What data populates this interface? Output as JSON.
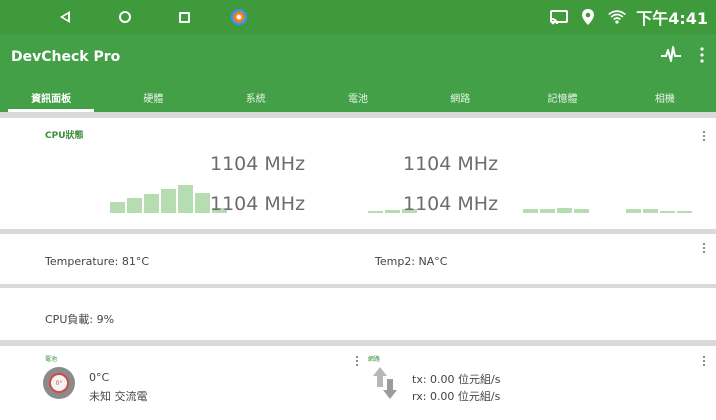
{
  "system_status": {
    "time": "下午4:41",
    "icons": [
      "back-icon",
      "home-icon",
      "recent-icon",
      "app-icon",
      "cast-icon",
      "location-icon",
      "wifi-icon"
    ]
  },
  "app": {
    "title": "DevCheck Pro",
    "actions": [
      "pulse-icon",
      "more-icon"
    ]
  },
  "tabs": [
    {
      "label": "資訊面板",
      "active": true
    },
    {
      "label": "硬體",
      "active": false
    },
    {
      "label": "系統",
      "active": false
    },
    {
      "label": "電池",
      "active": false
    },
    {
      "label": "網路",
      "active": false
    },
    {
      "label": "記憶體",
      "active": false
    },
    {
      "label": "相機",
      "active": false
    }
  ],
  "cpu": {
    "title": "CPU狀態",
    "freqs": [
      "1104 MHz",
      "1104 MHz",
      "1104 MHz",
      "1104 MHz"
    ],
    "bar_groups": [
      [
        0.32,
        0.45,
        0.55,
        0.7,
        0.82,
        0.58,
        0.15
      ],
      [
        0.05,
        0.08,
        0.12
      ],
      [
        0.12,
        0.12,
        0.14,
        0.12
      ],
      [
        0.12,
        0.12,
        0.05,
        0.05
      ]
    ]
  },
  "temperature": {
    "temp1": "Temperature: 81°C",
    "temp2": "Temp2: NA°C"
  },
  "cpu_load": {
    "text": "CPU負載: 9%"
  },
  "battery": {
    "label": "電池",
    "icon_text": "0°",
    "temp": "0°C",
    "status": "未知 交流電"
  },
  "network": {
    "label": "網路",
    "tx": "tx: 0.00 位元組/s",
    "rx": "rx: 0.00 位元組/s"
  },
  "colors": {
    "status_bar": "#3f9a3c",
    "app_bar": "#43a047",
    "accent": "#3b8f38",
    "bar_fill": "#b6dcb2"
  }
}
